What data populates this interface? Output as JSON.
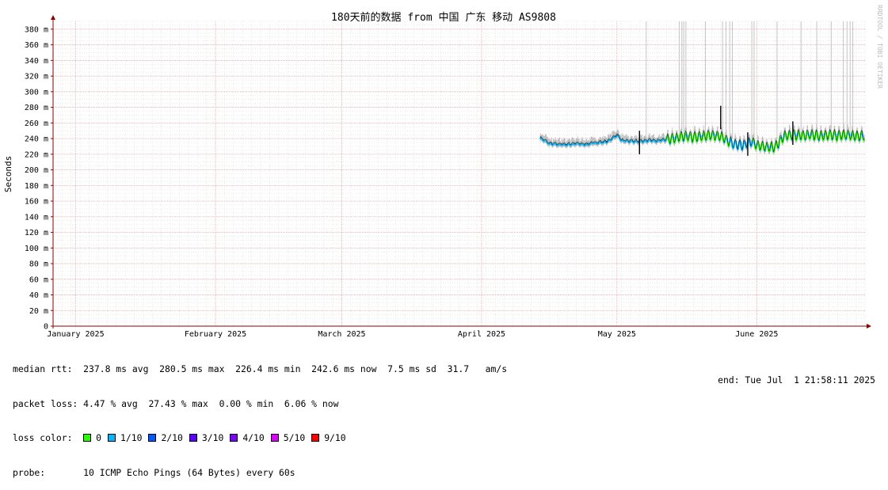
{
  "colors": {
    "grid_major": "#e8a0a0",
    "grid_minor": "#dddddd",
    "axis": "#8b0000",
    "line": "#000000",
    "smoke": "#bdbdbd",
    "loss_0": "#26ff00",
    "loss_1": "#00b8ff",
    "loss_2": "#0059ff"
  },
  "chart_data": {
    "type": "line",
    "title": "180天前的数据 from 中国 广东 移动 AS9808",
    "ylabel": "Seconds",
    "watermark": "RRDTOOL / TOBI OETIKER",
    "ylim": [
      0,
      390
    ],
    "y_ticks": [
      {
        "value": 0,
        "label": "0"
      },
      {
        "value": 20,
        "label": "20 m"
      },
      {
        "value": 40,
        "label": "40 m"
      },
      {
        "value": 60,
        "label": "60 m"
      },
      {
        "value": 80,
        "label": "80 m"
      },
      {
        "value": 100,
        "label": "100 m"
      },
      {
        "value": 120,
        "label": "120 m"
      },
      {
        "value": 140,
        "label": "140 m"
      },
      {
        "value": 160,
        "label": "160 m"
      },
      {
        "value": 180,
        "label": "180 m"
      },
      {
        "value": 200,
        "label": "200 m"
      },
      {
        "value": 220,
        "label": "220 m"
      },
      {
        "value": 240,
        "label": "240 m"
      },
      {
        "value": 260,
        "label": "260 m"
      },
      {
        "value": 280,
        "label": "280 m"
      },
      {
        "value": 300,
        "label": "300 m"
      },
      {
        "value": 320,
        "label": "320 m"
      },
      {
        "value": 340,
        "label": "340 m"
      },
      {
        "value": 360,
        "label": "360 m"
      },
      {
        "value": 380,
        "label": "380 m"
      }
    ],
    "x_range_days": [
      0,
      180
    ],
    "x_ticks": [
      {
        "day": 5,
        "label": "January 2025"
      },
      {
        "day": 36,
        "label": "February 2025"
      },
      {
        "day": 64,
        "label": "March 2025"
      },
      {
        "day": 95,
        "label": "April 2025"
      },
      {
        "day": 125,
        "label": "May 2025"
      },
      {
        "day": 156,
        "label": "June 2025"
      }
    ],
    "series": [
      {
        "name": "median rtt",
        "x": [
          108,
          109,
          110,
          112,
          114,
          116,
          118,
          120,
          122,
          123,
          124,
          125,
          126,
          128,
          130,
          132,
          134,
          136,
          138,
          140,
          142,
          144,
          146,
          148,
          150,
          151,
          152,
          153,
          155,
          156,
          158,
          160,
          162,
          164,
          166,
          168,
          170,
          172,
          174,
          176,
          178,
          180
        ],
        "y": [
          240,
          237,
          233,
          232,
          232,
          233,
          232,
          234,
          235,
          236,
          240,
          244,
          237,
          236,
          236,
          237,
          237,
          238,
          240,
          242,
          241,
          242,
          244,
          242,
          235,
          232,
          231,
          231,
          236,
          230,
          229,
          228,
          242,
          244,
          243,
          244,
          243,
          244,
          243,
          244,
          242,
          243
        ]
      }
    ],
    "spikes": [
      {
        "day": 130,
        "value": 250
      },
      {
        "day": 148,
        "value": 282
      },
      {
        "day": 154,
        "value": 248
      },
      {
        "day": 164,
        "value": 262
      }
    ]
  },
  "stats": {
    "median_rtt": "median rtt:  237.8 ms avg  280.5 ms max  226.4 ms min  242.6 ms now  7.5 ms sd  31.7   am/s",
    "packet_loss": "packet loss: 4.47 % avg  27.43 % max  0.00 % min  6.06 % now",
    "loss_color_label": "loss color:  ",
    "probe": "probe:       10 ICMP Echo Pings (64 Bytes) every 60s",
    "end": "end: Tue Jul  1 21:58:11 2025"
  },
  "loss_colors": [
    {
      "label": "0",
      "color": "#26ff00"
    },
    {
      "label": "1/10",
      "color": "#00b8ff"
    },
    {
      "label": "2/10",
      "color": "#0059ff"
    },
    {
      "label": "3/10",
      "color": "#5e00ff"
    },
    {
      "label": "4/10",
      "color": "#7e00ff"
    },
    {
      "label": "5/10",
      "color": "#dd00ff"
    },
    {
      "label": "9/10",
      "color": "#ff0000"
    }
  ]
}
